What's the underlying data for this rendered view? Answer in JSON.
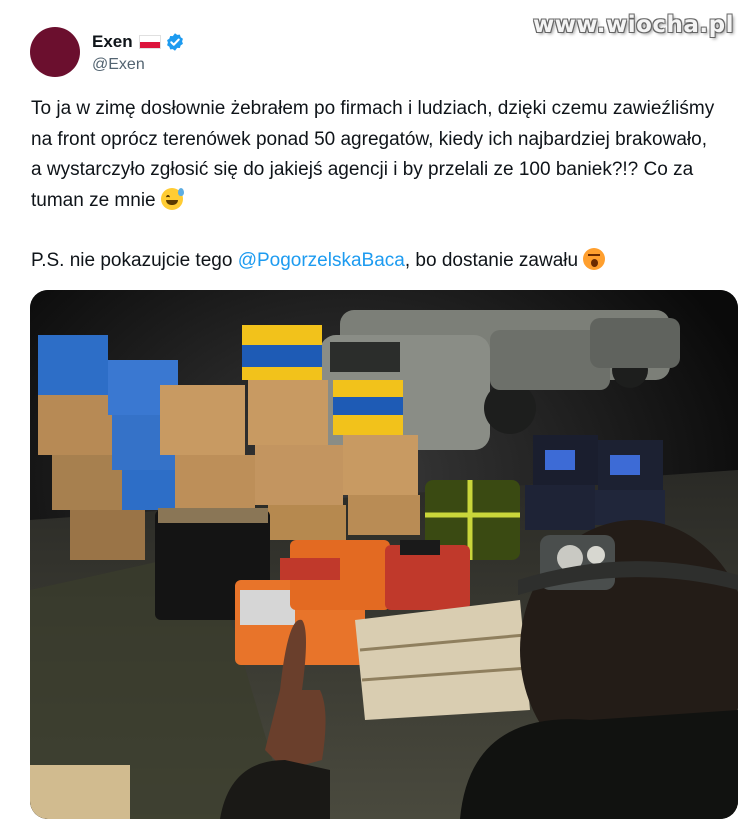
{
  "watermark": {
    "text": "www.wiocha.pl"
  },
  "author": {
    "display_name": "Exen",
    "handle": "@Exen",
    "avatar_color": "#6b0f2e",
    "flag_icon": "flag-poland-icon",
    "verified_icon": "verified-badge-icon"
  },
  "tweet": {
    "text_main": "To ja w zimę dosłownie żebrałem po firmach i ludziach, dzięki czemu zawieźliśmy na front oprócz terenówek ponad 50 agregatów, kiedy ich najbardziej brakowało, a wystarczyło zgłosić się do jakiejś agencji i by przelali ze 100 baniek?!? Co za tuman ze mnie",
    "emoji_1": "grinning-face-with-sweat-emoji",
    "ps_before": "P.S. nie pokazujcie tego ",
    "mention": "@PogorzelskaBaca",
    "ps_after": ", bo dostanie zawału",
    "emoji_2": "astonished-face-emoji"
  },
  "media": {
    "description_icon": "night-photo-generators-pallet",
    "accent_colors": {
      "generator_orange": "#e8742a",
      "box_yellow": "#f2c21b",
      "box_blue": "#1e5bb5",
      "cardboard": "#c89a62"
    }
  },
  "colors": {
    "link": "#1d9bf0",
    "text": "#0f1419",
    "secondary": "#536471"
  }
}
